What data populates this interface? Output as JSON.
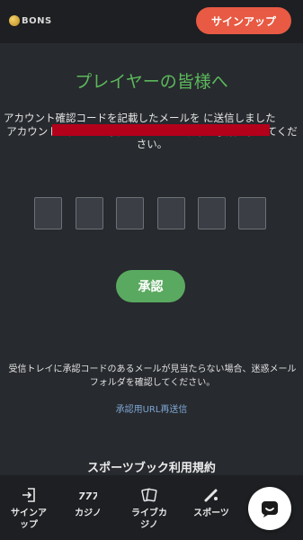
{
  "header": {
    "logo_text": "BONS",
    "signup_label": "サインアップ"
  },
  "main": {
    "title": "プレイヤーの皆様へ",
    "message_line1": "アカウント確認コードを記載したメールを に送信しました",
    "message_line2": "アカウント承認する必要があります。 以下の手順に従ってください。",
    "code_boxes": [
      "",
      "",
      "",
      "",
      "",
      ""
    ],
    "approve_label": "承認",
    "help_text": "受信トレイに承認コードのあるメールが見当たらない場合、迷惑メールフォルダを確認してください。",
    "resend_label": "承認用URL再送信",
    "terms_label": "スポーツブック利用規約"
  },
  "nav": {
    "items": [
      {
        "label": "サインア\nップ",
        "icon": "signin-icon"
      },
      {
        "label": "カジノ",
        "icon": "slot-icon"
      },
      {
        "label": "ライブカ\nジノ",
        "icon": "cards-icon"
      },
      {
        "label": "スポーツ",
        "icon": "bat-icon"
      },
      {
        "label": "ー",
        "icon": "more-icon"
      }
    ]
  },
  "chat": {
    "icon": "chat-icon"
  },
  "colors": {
    "accent_green": "#5aa960",
    "signup_red": "#e85a43",
    "link_blue": "#7ea6d4",
    "background": "#272a2e"
  }
}
